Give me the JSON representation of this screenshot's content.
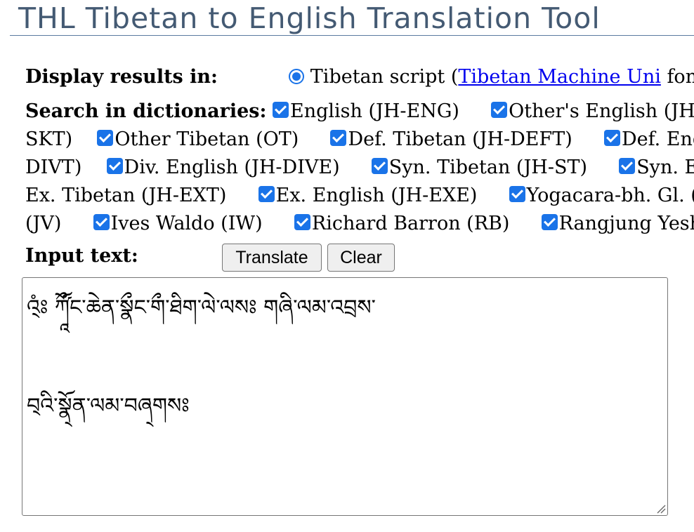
{
  "page": {
    "title": "THL Tibetan to English Translation Tool"
  },
  "display": {
    "label": "Display results in:",
    "option_tibetan_prefix": "Tibetan script (",
    "option_tibetan_link": "Tibetan Machine Uni",
    "option_tibetan_suffix": " font)"
  },
  "dictionaries": {
    "label": "Search in dictionaries:",
    "items": [
      "English (JH-ENG)",
      "Other's English (JH-OE",
      "SKT)",
      "Other Tibetan (OT)",
      "Def. Tibetan (JH-DEFT)",
      "Def. Engl",
      "DIVT)",
      "Div. English (JH-DIVE)",
      "Syn. Tibetan (JH-ST)",
      "Syn. E",
      "Ex. Tibetan (JH-EXT)",
      "Ex. English (JH-EXE)",
      "Yogacara-bh. Gl. (Y",
      "(JV)",
      "Ives Waldo (IW)",
      "Richard Barron (RB)",
      "Rangjung Yeshe ("
    ]
  },
  "input": {
    "label": "Input text:",
    "translate_label": "Translate",
    "clear_label": "Clear",
    "text": "འ྄ཾཿ ཀཱྀོ༹ང་ཆེན་སྣྀང་གྀ་ཐིག་ལེ་ལསཿ གཞི་ལམ་འབྲས་\n\nབ྄འི་སྣ྄ོན་ལམ་བཞ྄གསཿ"
  },
  "colors": {
    "title": "#445a73",
    "accent": "#1a73e8",
    "link": "#0000ee"
  }
}
